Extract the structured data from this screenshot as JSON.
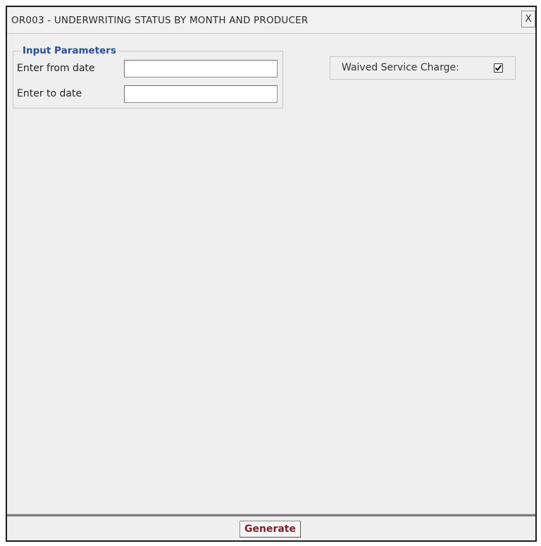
{
  "dialog": {
    "title": "OR003 - UNDERWRITING STATUS BY MONTH AND PRODUCER",
    "close_label": "X"
  },
  "input_parameters": {
    "legend": "Input Parameters",
    "from_date": {
      "label": "Enter from date",
      "value": ""
    },
    "to_date": {
      "label": "Enter to date",
      "value": ""
    }
  },
  "options": {
    "waived_service_charge": {
      "label": "Waived Service Charge:",
      "checked": true
    }
  },
  "footer": {
    "generate_label": "Generate"
  },
  "colors": {
    "legend_text": "#2a4f93",
    "button_text": "#7a1e2c",
    "dialog_background": "#efefef"
  },
  "icons": {
    "close": "close-icon",
    "checkmark": "checkmark-icon"
  }
}
